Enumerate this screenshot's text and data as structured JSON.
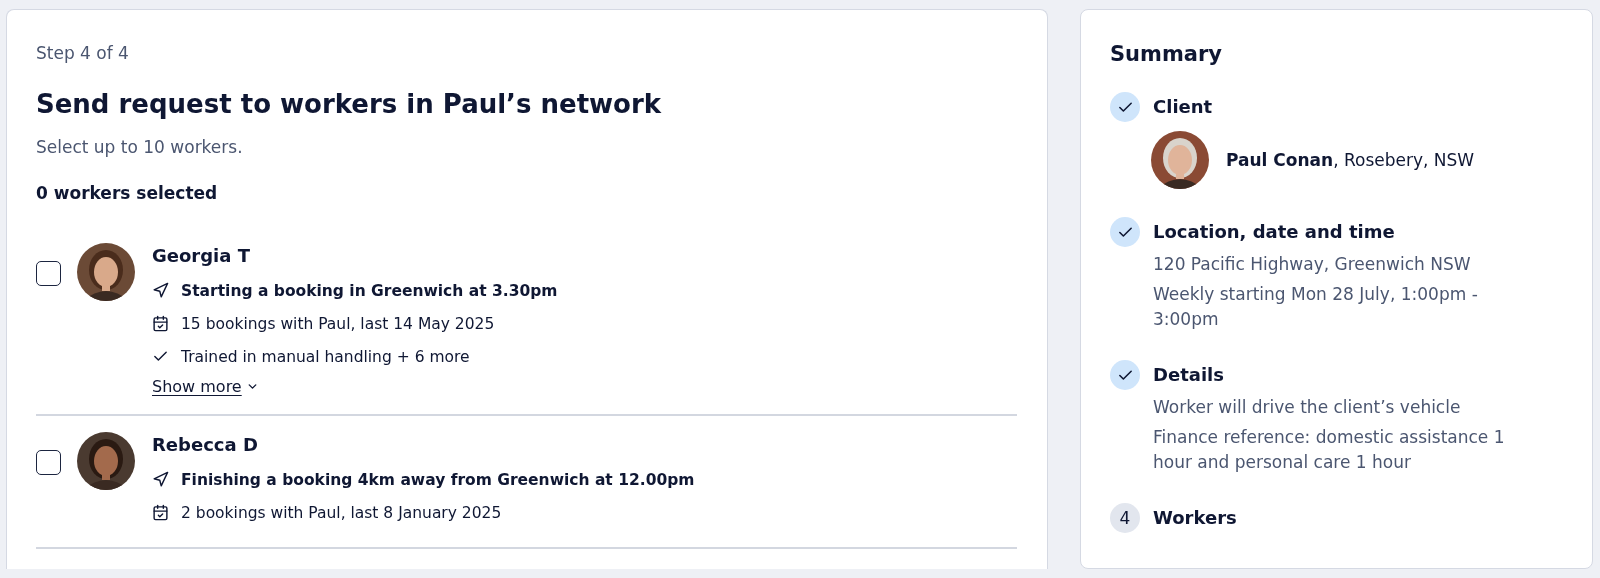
{
  "request": {
    "step": "Step 4 of 4",
    "title": "Send request to workers in Paul’s network",
    "subtitle": "Select up to 10 workers.",
    "selected_count": "0 workers selected",
    "workers": [
      {
        "name": "Georgia T",
        "checked": false,
        "details": [
          {
            "kind": "location",
            "text": "Starting a booking in Greenwich at 3.30pm"
          },
          {
            "kind": "bookings",
            "text": "15 bookings with Paul, last 14 May 2025"
          },
          {
            "kind": "training",
            "text": "Trained in manual handling + 6 more"
          }
        ],
        "show_more": "Show more"
      },
      {
        "name": "Rebecca D",
        "checked": false,
        "details": [
          {
            "kind": "location",
            "text": "Finishing a booking 4km away from Greenwich at 12.00pm"
          },
          {
            "kind": "bookings",
            "text": "2 bookings with Paul, last 8 January 2025"
          }
        ]
      }
    ]
  },
  "summary": {
    "title": "Summary",
    "steps": [
      {
        "done": true,
        "title": "Client",
        "client": "**Paul Conan**, Rosebery, NSW"
      },
      {
        "done": true,
        "title": "Location, date and time",
        "lines": [
          "120 Pacific Highway, Greenwich NSW",
          "Weekly starting Mon 28 July, 1:00pm - 3:00pm"
        ]
      },
      {
        "done": true,
        "title": "Details",
        "lines": [
          "Worker will drive the client’s vehicle",
          "Finance reference: domestic assistance 1 hour and personal care 1 hour"
        ]
      },
      {
        "done": false,
        "number": "4",
        "title": "Workers"
      }
    ]
  }
}
